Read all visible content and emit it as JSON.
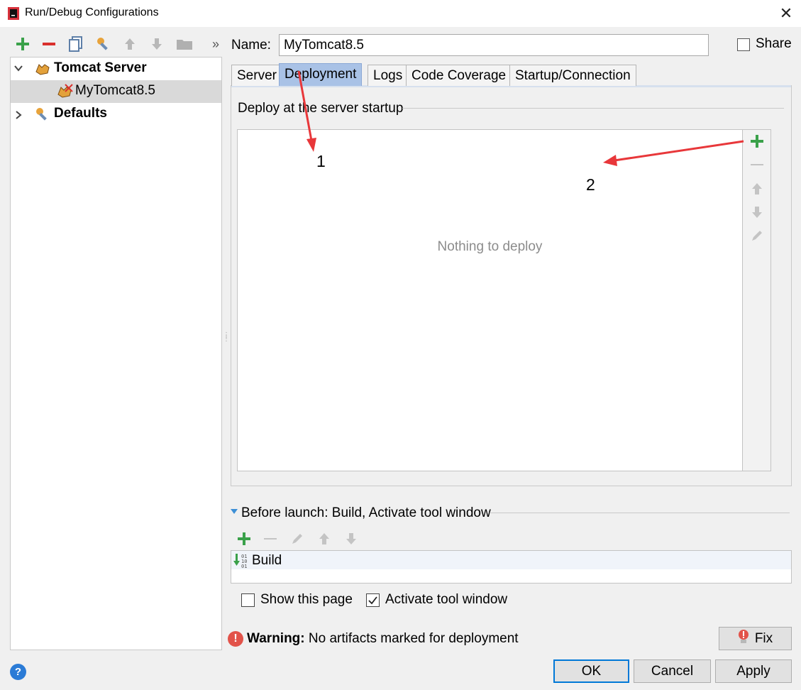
{
  "window": {
    "title": "Run/Debug Configurations"
  },
  "left_toolbar": {
    "icons": [
      "add-icon",
      "remove-icon",
      "copy-icon",
      "edit-defaults-icon",
      "move-up-icon",
      "move-down-icon",
      "folder-icon",
      "more-icon"
    ],
    "more_glyph": "»"
  },
  "tree": {
    "items": [
      {
        "label": "Tomcat Server",
        "expanded": true,
        "icon": "tomcat-icon"
      },
      {
        "label": "MyTomcat8.5",
        "selected": true,
        "icon": "tomcat-config-icon"
      },
      {
        "label": "Defaults",
        "expanded": false,
        "icon": "defaults-wrench-icon"
      }
    ]
  },
  "name_field": {
    "label": "Name:",
    "value": "MyTomcat8.5"
  },
  "share": {
    "label": "Share",
    "checked": false
  },
  "tabs": [
    {
      "label": "Server",
      "active": false
    },
    {
      "label": "Deployment",
      "active": true
    },
    {
      "label": "Logs",
      "active": false
    },
    {
      "label": "Code Coverage",
      "active": false
    },
    {
      "label": "Startup/Connection",
      "active": false
    }
  ],
  "deployment": {
    "header": "Deploy at the server startup",
    "empty_text": "Nothing to deploy",
    "side_icons": [
      "add-icon",
      "remove-icon",
      "move-up-icon",
      "move-down-icon",
      "edit-icon"
    ]
  },
  "before_launch": {
    "label": "Before launch: Build, Activate tool window",
    "toolbar_icons": [
      "add-icon",
      "remove-icon",
      "edit-icon",
      "move-up-icon",
      "move-down-icon"
    ],
    "items": [
      {
        "label": "Build",
        "icon": "build-icon"
      }
    ]
  },
  "options": {
    "show_page": {
      "label": "Show this page",
      "checked": false
    },
    "activate_tool_window": {
      "label": "Activate tool window",
      "checked": true
    }
  },
  "warning": {
    "bold": "Warning:",
    "text": " No artifacts marked for deployment"
  },
  "buttons": {
    "fix": "Fix",
    "ok": "OK",
    "cancel": "Cancel",
    "apply": "Apply"
  },
  "annotations": {
    "arrow1": "1",
    "arrow2": "2",
    "color": "#e8373a"
  },
  "colors": {
    "add_green": "#3aa14a",
    "remove_red": "#d9302c",
    "active_tab": "#a9c2e6",
    "help_blue": "#2b7bd6"
  }
}
